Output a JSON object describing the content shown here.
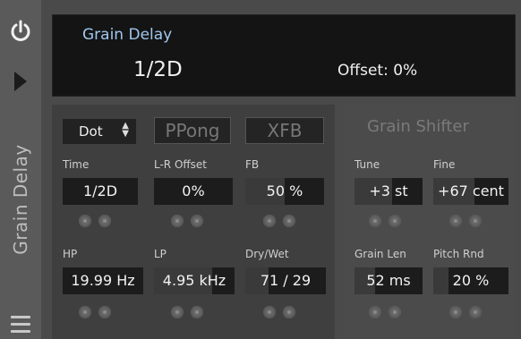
{
  "device": {
    "sidebar_title": "Grain Delay",
    "header": {
      "title": "Grain Delay",
      "main_value": "1/2D",
      "offset_text": "Offset: 0%"
    }
  },
  "delay": {
    "mode_select": "Dot",
    "ppong_label": "PPong",
    "xfb_label": "XFB",
    "params": {
      "time": {
        "label": "Time",
        "value": "1/2D"
      },
      "lr": {
        "label": "L-R Offset",
        "value": "0%"
      },
      "fb": {
        "label": "FB",
        "value": "50 %",
        "fill": 0.5
      },
      "hp": {
        "label": "HP",
        "value": "19.99 Hz"
      },
      "lp": {
        "label": "LP",
        "value": "4.95 kHz",
        "fill": 0.72
      },
      "drywet": {
        "label": "Dry/Wet",
        "value": "71 / 29",
        "fill": 0.29
      }
    }
  },
  "grain_shifter": {
    "title": "Grain Shifter",
    "params": {
      "tune": {
        "label": "Tune",
        "value": "+3 st",
        "fill": 0.55
      },
      "fine": {
        "label": "Fine",
        "value": "+67 cent",
        "fill": 0.55
      },
      "grainlen": {
        "label": "Grain Len",
        "value": "52 ms",
        "fill": 0.3
      },
      "pitchrnd": {
        "label": "Pitch Rnd",
        "value": "20 %",
        "fill": 0.2
      }
    }
  },
  "colors": {
    "title_accent": "#9ec8f0",
    "knob": "#666666"
  },
  "icons": {
    "power": "power-icon",
    "play": "play-icon",
    "menu": "hamburger-menu-icon",
    "select_arrows": "up-down-arrows-icon",
    "knob": "knob-icon"
  }
}
